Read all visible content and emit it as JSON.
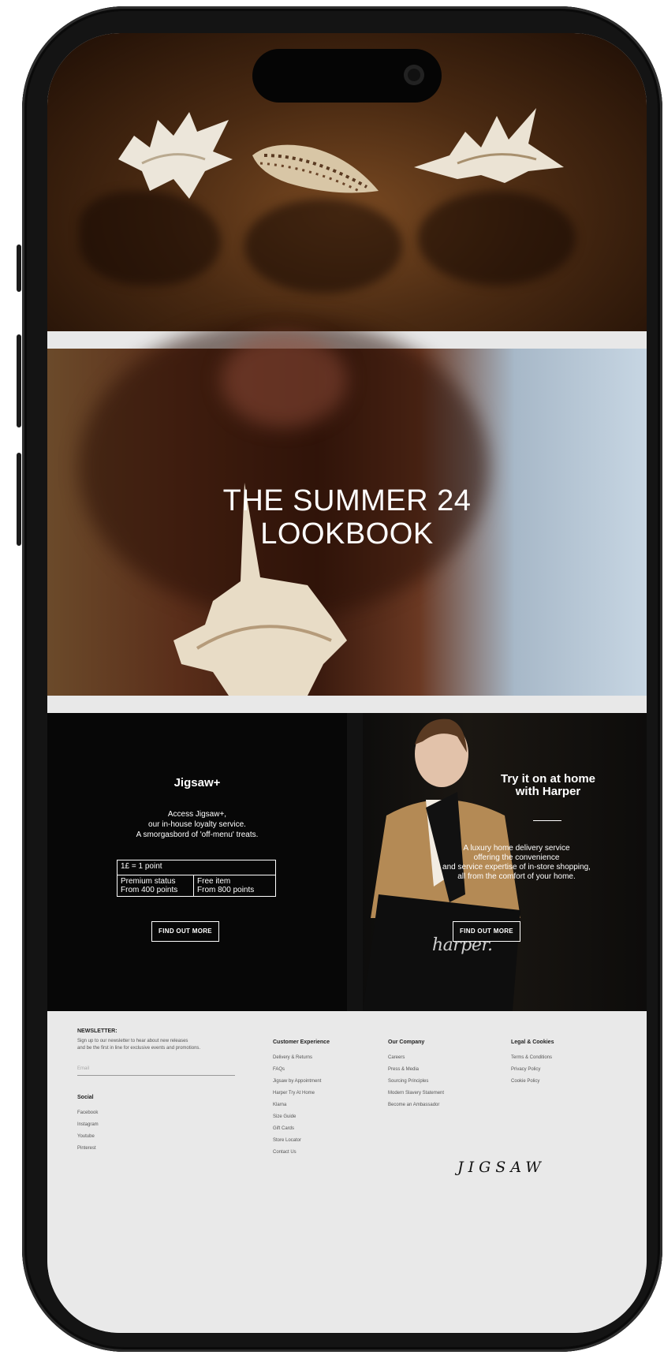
{
  "hero": {
    "image_alt_icon": "seashells-image"
  },
  "lookbook": {
    "title_line1": "THE SUMMER 24",
    "title_line2": "LOOKBOOK"
  },
  "jigsaw_plus": {
    "title": "Jigsaw+",
    "desc_line1": "Access Jigsaw+,",
    "desc_line2": "our in-house loyalty service.",
    "desc_line3": "A smorgasbord of 'off-menu' treats.",
    "points_rate": "1£ = 1 point",
    "premium_label": "Premium status",
    "premium_points": "From 400 points",
    "free_label": "Free item",
    "free_points": "From 800 points",
    "button": "FIND OUT MORE"
  },
  "harper": {
    "title_line1": "Try it on at home",
    "title_line2": "with Harper",
    "desc_line1": "A luxury home delivery service",
    "desc_line2": "offering the convenience",
    "desc_line3": "and service expertise of in-store shopping,",
    "desc_line4": "all from the comfort of your home.",
    "button": "FIND OUT MORE",
    "logo": "harper."
  },
  "footer": {
    "newsletter_title": "NEWSLETTER:",
    "newsletter_line1": "Sign up to our newsletter to hear about new releases",
    "newsletter_line2": "and be the first in line for exclusive events and promotions.",
    "email_placeholder": "Email",
    "social_title": "Social",
    "social": [
      "Facebook",
      "Instagram",
      "Youtube",
      "Pinterest"
    ],
    "cx_title": "Customer Experience",
    "cx": [
      "Delivery & Returns",
      "FAQs",
      "Jigsaw by Appointment",
      "Harper Try At Home",
      "Klarna",
      "Size Guide",
      "Gift Cards",
      "Store Locator",
      "Contact Us"
    ],
    "company_title": "Our Company",
    "company": [
      "Careers",
      "Press & Media",
      "Sourcing Principles",
      "Modern Slavery Statement",
      "Become an Ambassador"
    ],
    "legal_title": "Legal & Cookies",
    "legal": [
      "Terms & Conditions",
      "Privacy Policy",
      "Cookie Policy"
    ],
    "logo": "JIGSAW"
  }
}
